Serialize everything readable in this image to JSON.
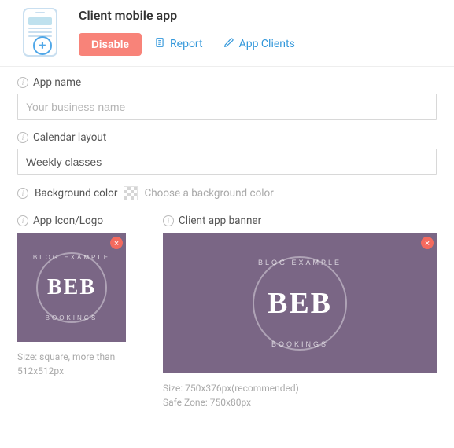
{
  "header": {
    "title": "Client mobile app",
    "disable_label": "Disable",
    "report_label": "Report",
    "app_clients_label": "App Clients"
  },
  "fields": {
    "app_name_label": "App name",
    "app_name_placeholder": "Your business name",
    "calendar_label": "Calendar layout",
    "calendar_value": "Weekly classes",
    "bg_color_label": "Background color",
    "bg_color_hint": "Choose a background color"
  },
  "logo": {
    "label": "App Icon/Logo",
    "brand_top": "BLOG EXAMPLE",
    "brand_mid": "BEB",
    "brand_bottom": "BOOKINGS",
    "hint": "Size: square, more than 512x512px"
  },
  "banner": {
    "label": "Client app banner",
    "brand_top": "BLOG EXAMPLE",
    "brand_mid": "BEB",
    "brand_bottom": "BOOKINGS",
    "hint_line1": "Size: 750x376px(recommended)",
    "hint_line2": "Safe Zone: 750x80px"
  }
}
